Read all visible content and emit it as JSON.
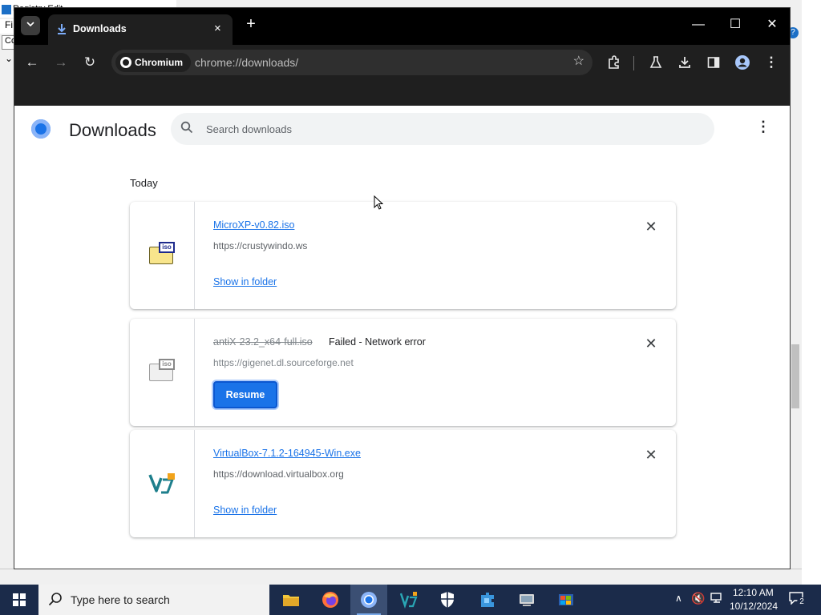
{
  "background_window": {
    "title": "Registry Edit",
    "menu": "Fi",
    "field": "Co",
    "help": "?"
  },
  "browser": {
    "tab": {
      "title": "Downloads",
      "close": "×",
      "icon": "download-icon"
    },
    "new_tab": "+",
    "window_controls": {
      "minimize": "—",
      "maximize": "☐",
      "close": "✕"
    },
    "toolbar": {
      "back": "←",
      "forward": "→",
      "reload": "↻"
    },
    "omnibox": {
      "site_chip": "Chromium",
      "url": "chrome://downloads/"
    },
    "toolbar_icons": [
      "bookmark-star-icon",
      "extensions-icon",
      "labs-icon",
      "downloads-icon",
      "side-panel-icon",
      "profile-icon",
      "menu-icon"
    ]
  },
  "page": {
    "title": "Downloads",
    "search": {
      "placeholder": "Search downloads"
    },
    "section_label": "Today",
    "downloads": [
      {
        "file_name": "MicroXP-v0.82.iso",
        "url": "https://crustywindo.ws",
        "action": "Show in folder",
        "icon": "iso-file-icon",
        "status": "complete"
      },
      {
        "file_name": "antiX-23.2_x64-full.iso",
        "status_text": "Failed - Network error",
        "url": "https://gigenet.dl.sourceforge.net",
        "action": "Resume",
        "icon": "iso-file-icon",
        "status": "failed"
      },
      {
        "file_name": "VirtualBox-7.1.2-164945-Win.exe",
        "url": "https://download.virtualbox.org",
        "action": "Show in folder",
        "icon": "virtualbox-icon",
        "status": "complete"
      }
    ]
  },
  "taskbar": {
    "search_placeholder": "Type here to search",
    "apps": [
      "file-explorer-icon",
      "firefox-icon",
      "chromium-icon",
      "virtualbox-icon",
      "security-shield-icon",
      "puzzle-app-icon",
      "network-app-icon",
      "windows-xp-icon"
    ],
    "clock": {
      "time": "12:10 AM",
      "date": "10/12/2024"
    },
    "notifications": "2"
  },
  "colors": {
    "accent": "#1a73e8",
    "titlebar": "#000000",
    "toolbar": "#1f1f1f",
    "taskbar": "#1b2b4a"
  }
}
